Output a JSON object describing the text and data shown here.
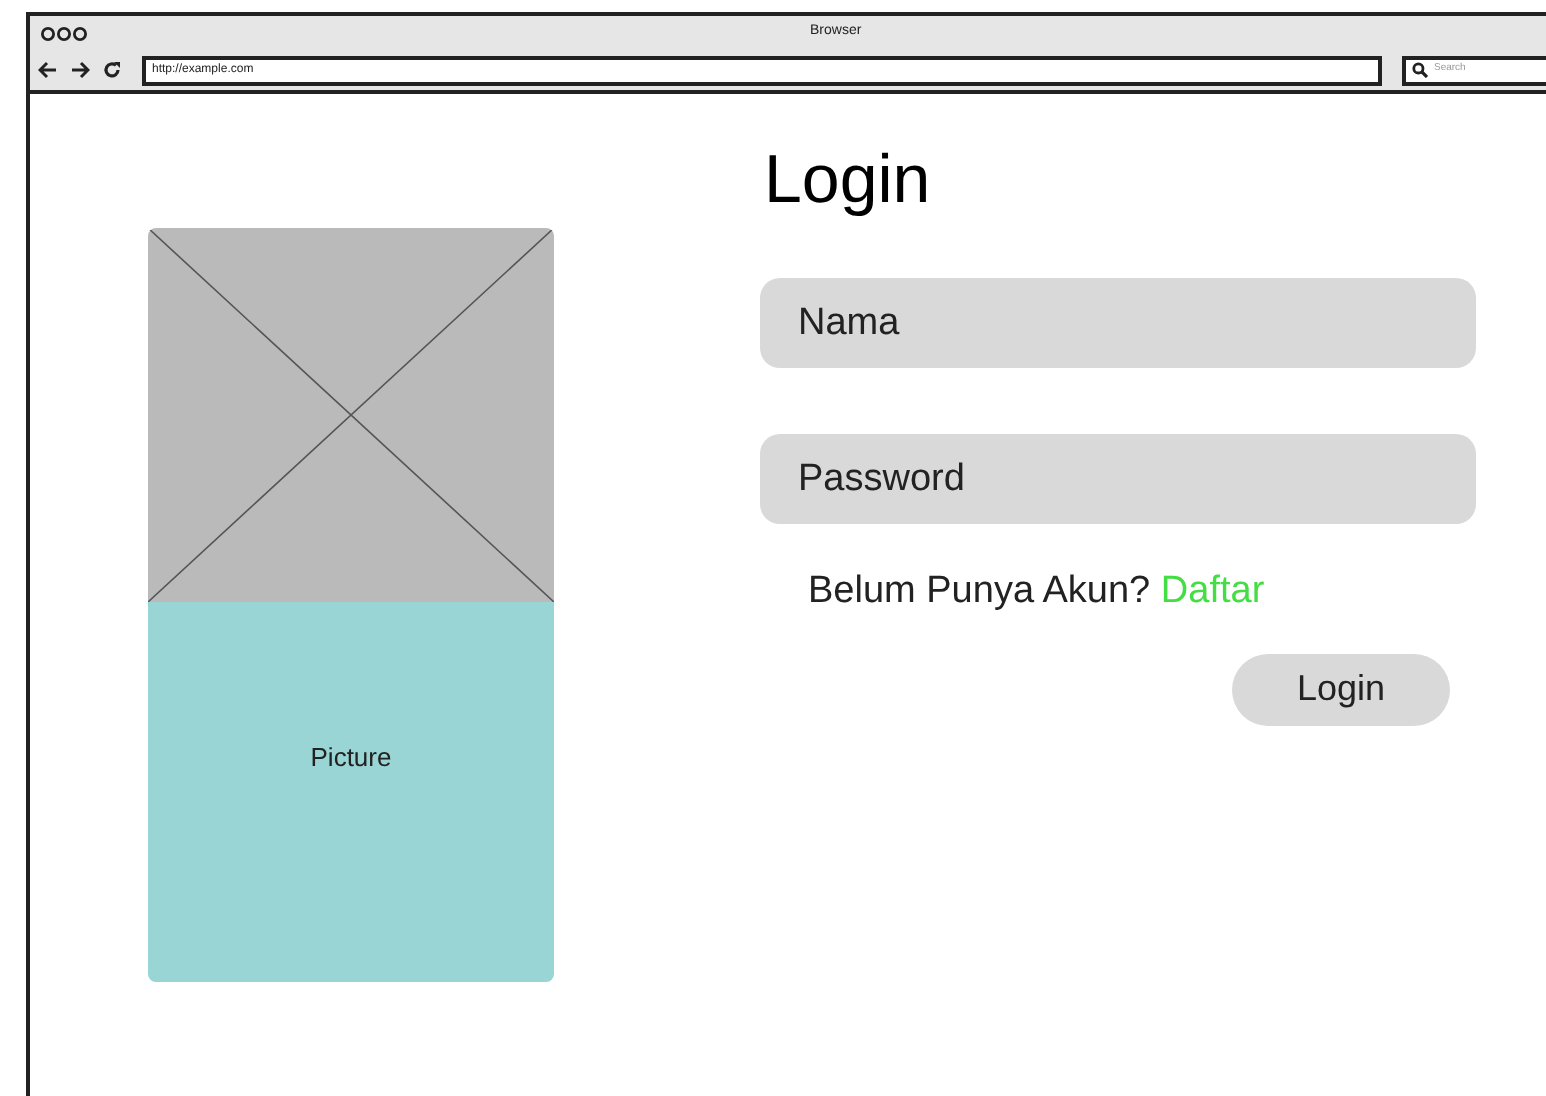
{
  "window": {
    "title": "Browser",
    "url": "http://example.com",
    "search_placeholder": "Search"
  },
  "picture": {
    "label": "Picture"
  },
  "heading": "Login",
  "fields": [
    {
      "placeholder": "Nama"
    },
    {
      "placeholder": "Password"
    }
  ],
  "signup": {
    "prompt": "Belum Punya Akun?",
    "link": "Daftar"
  },
  "button": "Login"
}
